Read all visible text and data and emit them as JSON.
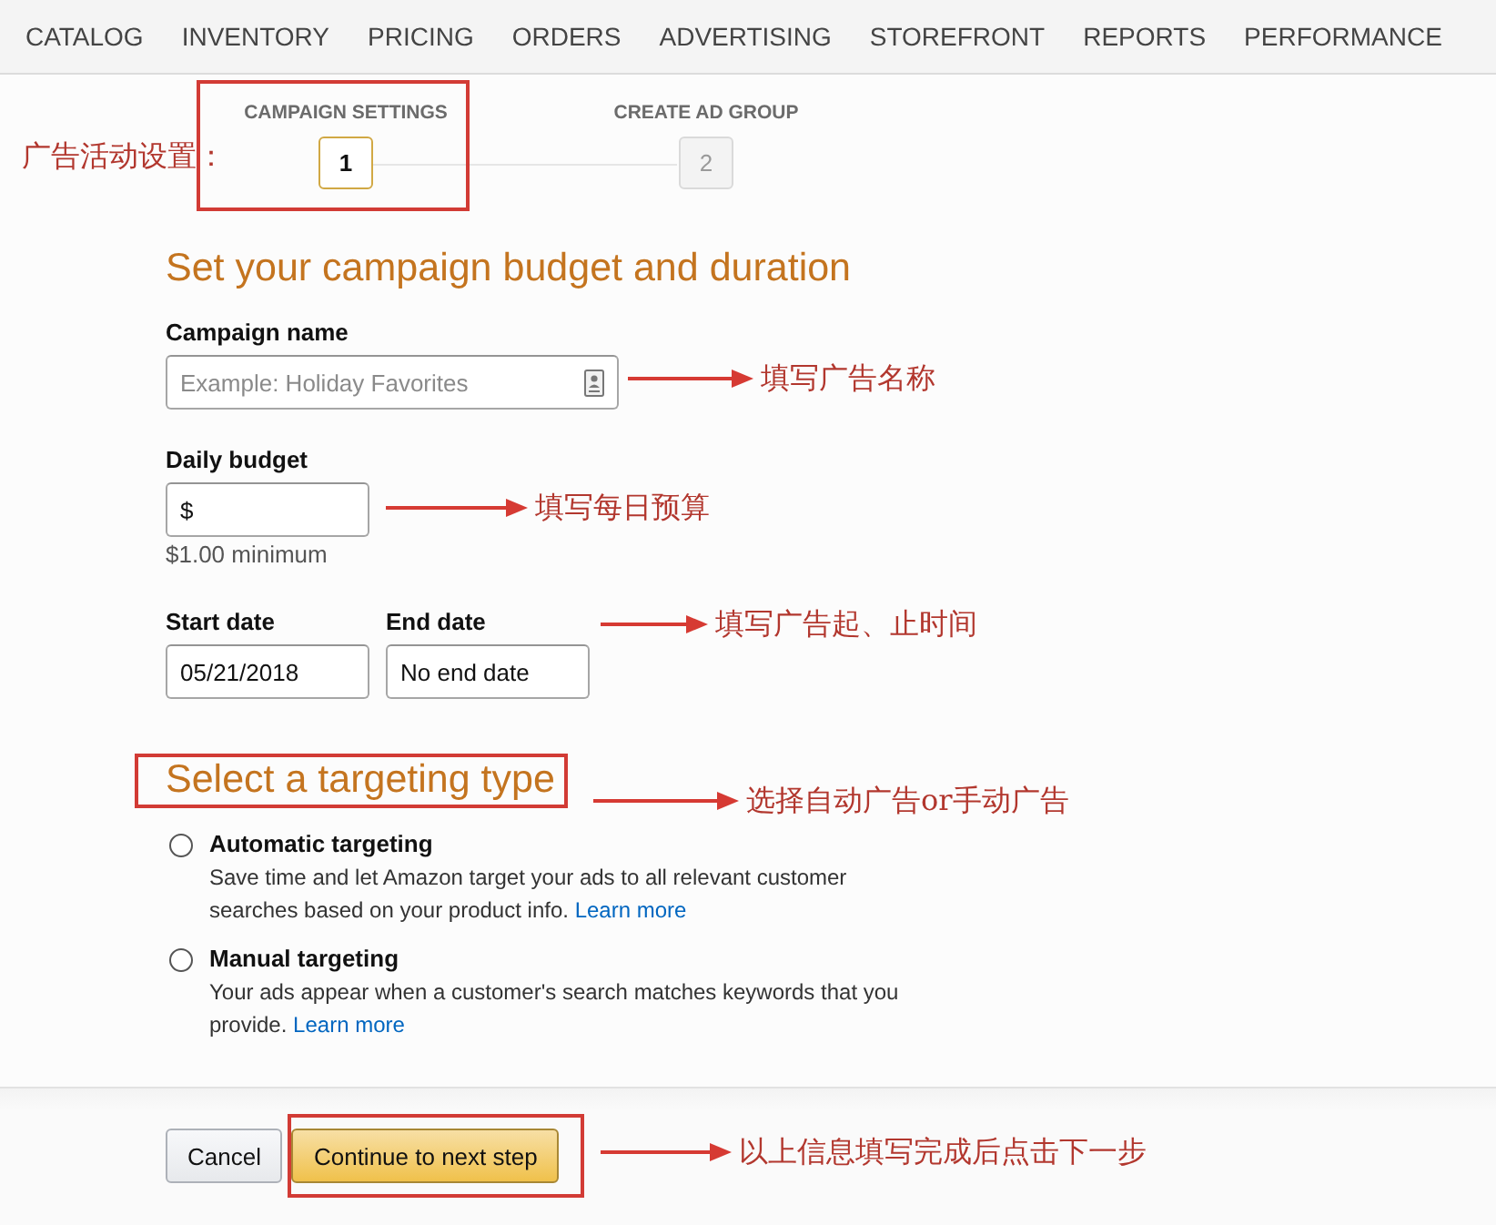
{
  "nav": {
    "items": [
      "CATALOG",
      "INVENTORY",
      "PRICING",
      "ORDERS",
      "ADVERTISING",
      "STOREFRONT",
      "REPORTS",
      "PERFORMANCE"
    ]
  },
  "stepper": {
    "steps": [
      {
        "number": "1",
        "label": "CAMPAIGN SETTINGS",
        "selected": true,
        "highlighted": true
      },
      {
        "number": "2",
        "label": "CREATE AD GROUP",
        "selected": false,
        "highlighted": false
      }
    ]
  },
  "budget_section": {
    "title": "Set your campaign budget and duration",
    "campaign_name": {
      "label": "Campaign name",
      "placeholder": "Example: Holiday Favorites"
    },
    "daily_budget": {
      "label": "Daily budget",
      "value": "$",
      "hint": "$1.00 minimum"
    },
    "start_date": {
      "label": "Start date",
      "value": "05/21/2018"
    },
    "end_date": {
      "label": "End date",
      "value": "No end date"
    }
  },
  "targeting_section": {
    "title": "Select a targeting type",
    "highlighted": true,
    "options": [
      {
        "title": "Automatic targeting",
        "description": "Save time and let Amazon target your ads to all relevant customer searches based on your product info.",
        "link": "Learn more",
        "selected": false
      },
      {
        "title": "Manual targeting",
        "description": "Your ads appear when a customer's search matches keywords that you provide.",
        "link": "Learn more",
        "selected": false
      }
    ]
  },
  "footer": {
    "buttons": [
      {
        "label": "Cancel",
        "kind": "secondary",
        "highlighted": false
      },
      {
        "label": "Continue to next step",
        "kind": "primary",
        "highlighted": true
      }
    ]
  },
  "annotations": [
    {
      "text": "广告活动设置：",
      "arrow": false
    },
    {
      "text": "填写广告名称",
      "arrow": true
    },
    {
      "text": "填写每日预算",
      "arrow": true
    },
    {
      "text": "填写广告起、止时间",
      "arrow": true
    },
    {
      "text": "选择自动广告or手动广告",
      "arrow": true
    },
    {
      "text": "以上信息填写完成后点击下一步",
      "arrow": true
    }
  ]
}
